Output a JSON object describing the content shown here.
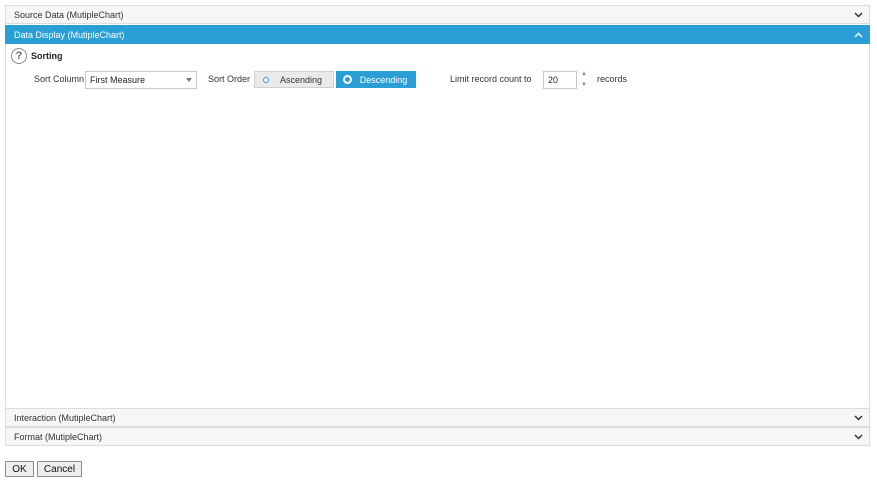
{
  "accordion": {
    "source": {
      "title": "Source Data (MutipleChart)"
    },
    "display": {
      "title": "Data Display (MutipleChart)"
    },
    "interaction": {
      "title": "Interaction (MutipleChart)"
    },
    "format": {
      "title": "Format (MutipleChart)"
    }
  },
  "sorting": {
    "section_title": "Sorting",
    "help_glyph": "?",
    "sort_column_label": "Sort Column",
    "sort_column_value": "First Measure",
    "sort_order_label": "Sort Order",
    "ascending_label": "Ascending",
    "descending_label": "Descending",
    "selected_order": "Descending",
    "limit_label": "Limit record count to",
    "limit_value": "20",
    "records_label": "records"
  },
  "buttons": {
    "ok": "OK",
    "cancel": "Cancel"
  },
  "colors": {
    "accent": "#2a9fd6",
    "header_bg": "#f6f6f6",
    "border": "#dcdcdc"
  },
  "icons": {
    "help": "help-icon",
    "collapse": "chevron-up-icon",
    "expand": "chevron-down-icon"
  }
}
